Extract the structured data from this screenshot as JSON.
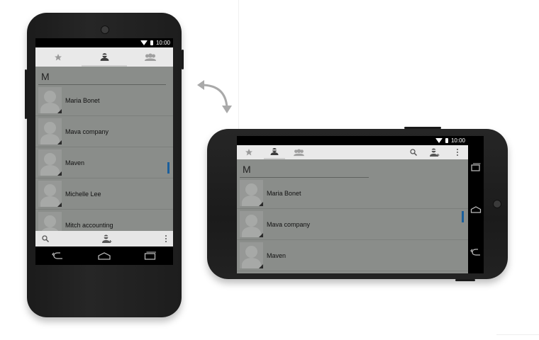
{
  "status": {
    "time": "10:00"
  },
  "portrait": {
    "section_letter": "M",
    "contacts": [
      "Maria Bonet",
      "Mava company",
      "Maven",
      "Michelle Lee",
      "Mitch accounting"
    ]
  },
  "landscape": {
    "section_letter": "M",
    "contacts": [
      "Maria Bonet",
      "Mava company",
      "Maven"
    ]
  },
  "colors": {
    "tab_bg": "#e9e9e9",
    "list_bg": "#8a8d8a",
    "scroll_indicator": "#1a5f9c",
    "device": "#1f1f1f"
  },
  "icons": [
    "star-icon",
    "person-icon",
    "group-icon",
    "search-icon",
    "add-contact-icon",
    "more-vert-icon",
    "back-icon",
    "home-icon",
    "recents-icon",
    "wifi-icon",
    "battery-icon",
    "rotate-arrow-icon"
  ]
}
